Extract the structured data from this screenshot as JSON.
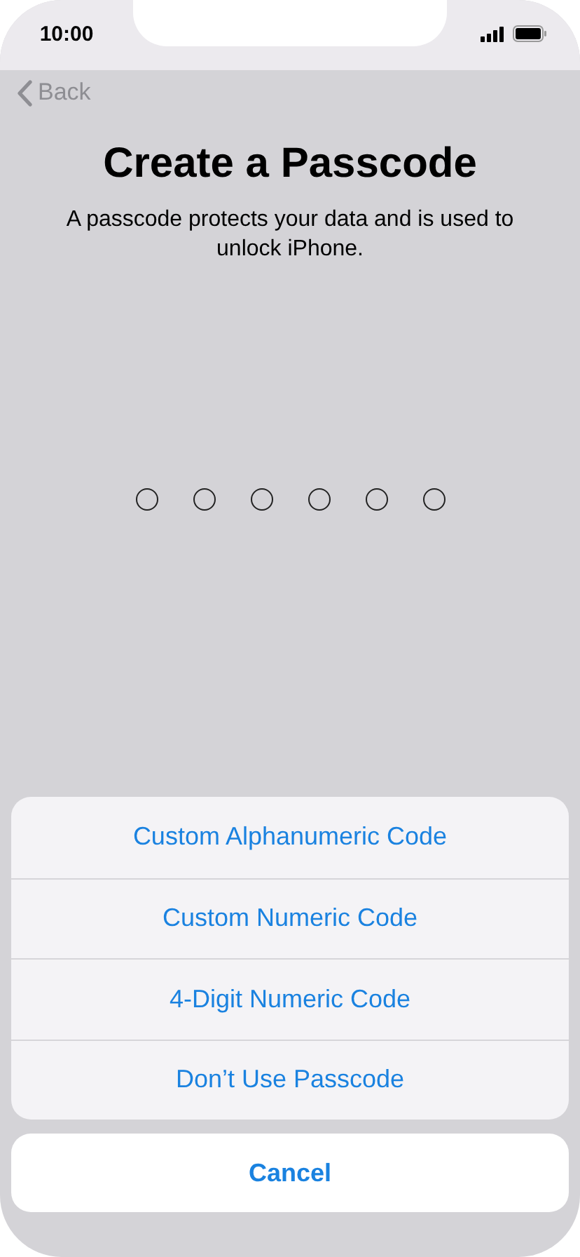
{
  "status_bar": {
    "time": "10:00"
  },
  "nav": {
    "back": "Back"
  },
  "title": "Create a Passcode",
  "description": "A passcode protects your data and is used to unlock iPhone.",
  "passcode_dots": [
    {
      "filled": false
    },
    {
      "filled": false
    },
    {
      "filled": false
    },
    {
      "filled": false
    },
    {
      "filled": false
    },
    {
      "filled": false
    }
  ],
  "action_sheet": {
    "options": [
      "Custom Alphanumeric Code",
      "Custom Numeric Code",
      "4-Digit Numeric Code",
      "Don’t Use Passcode"
    ],
    "cancel": "Cancel"
  }
}
